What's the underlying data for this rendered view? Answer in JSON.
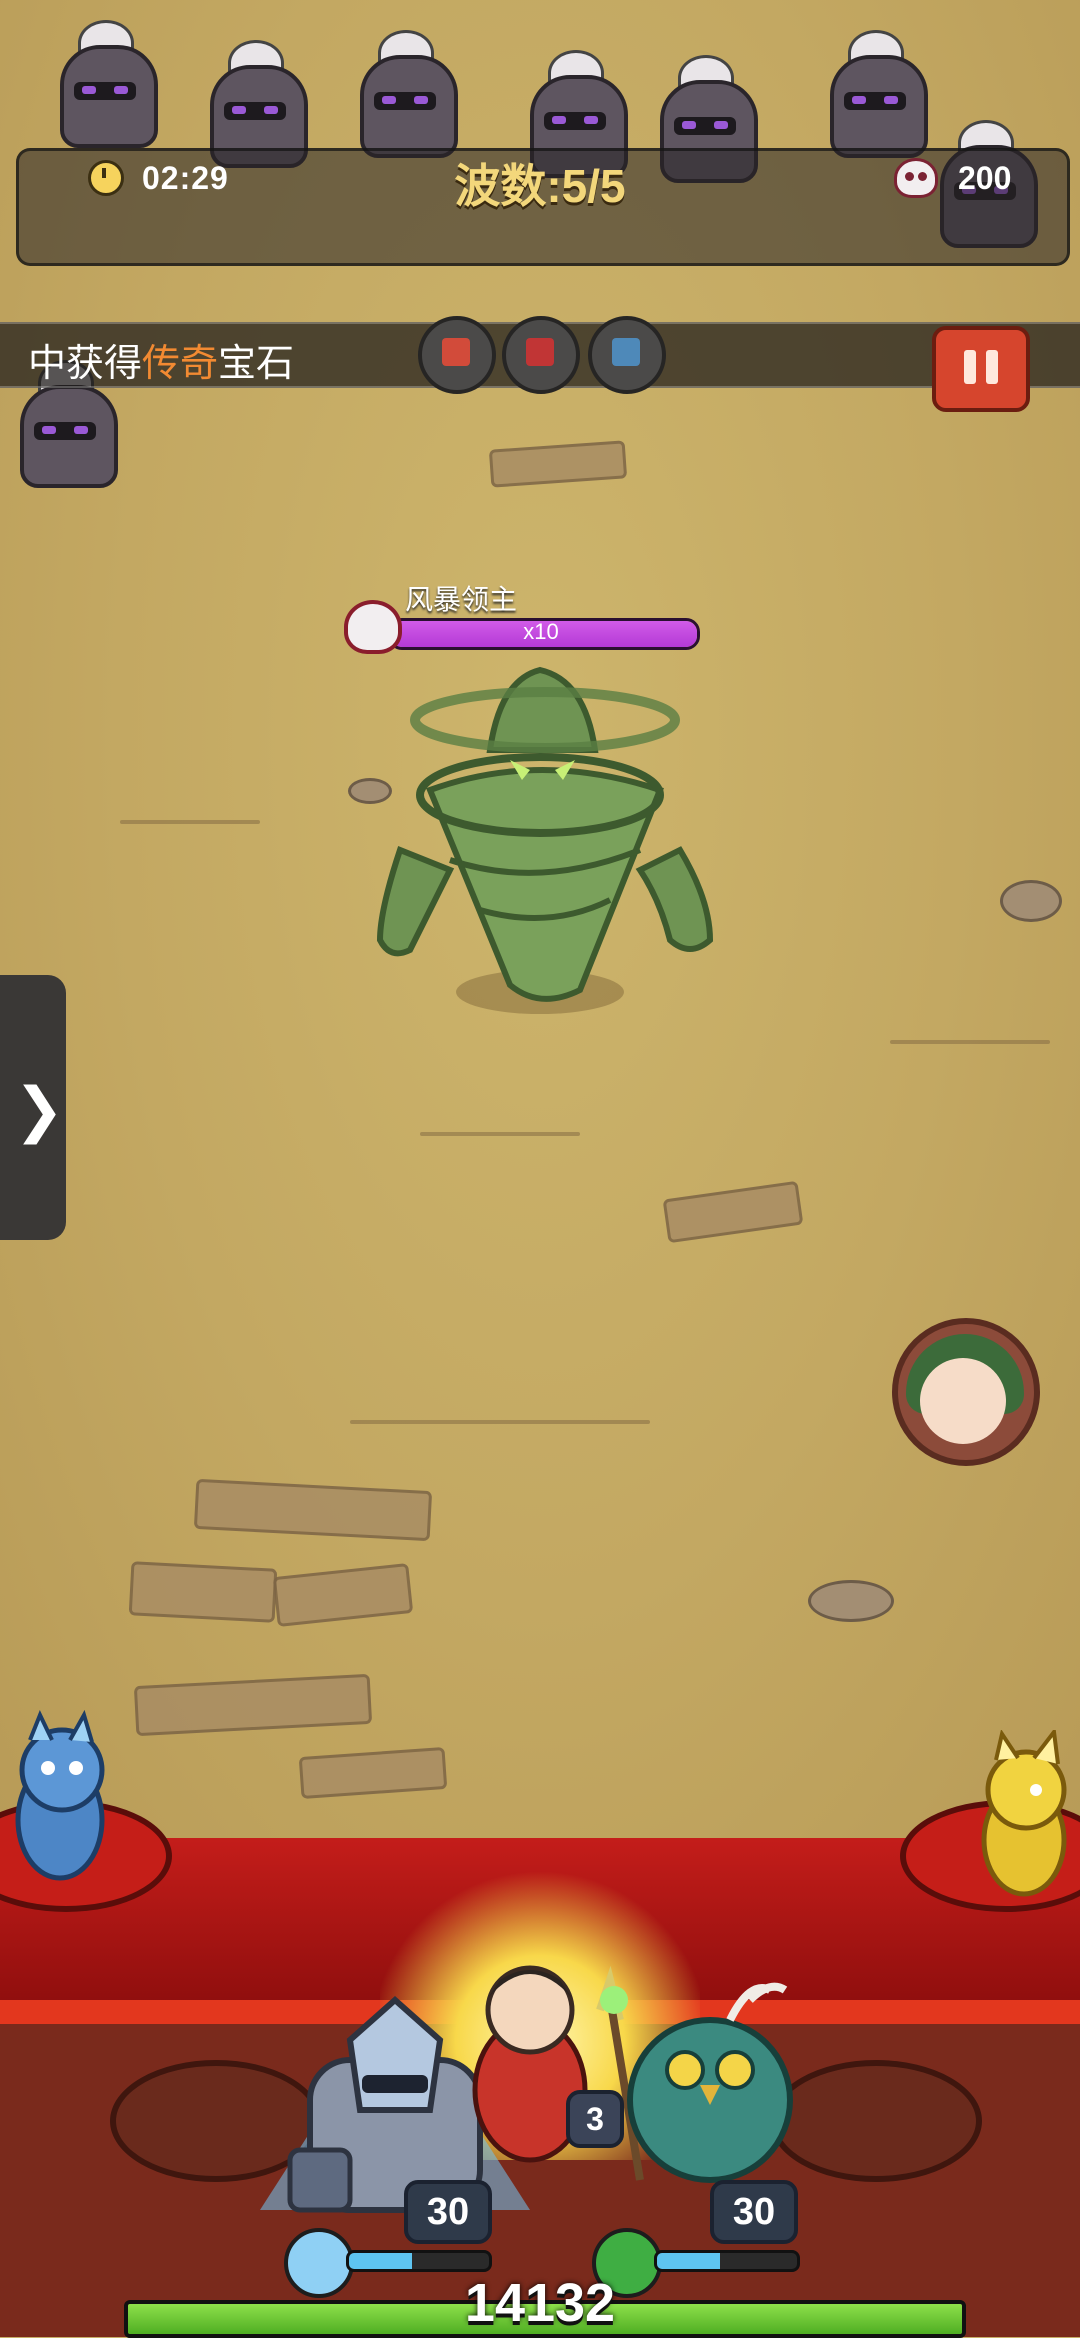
{
  "hud": {
    "timer": "02:29",
    "wave_label": "波数:5/5",
    "kill_count": "200"
  },
  "notice": {
    "prefix": "中获得",
    "highlight": "传奇",
    "suffix": "宝石"
  },
  "boss": {
    "name": "风暴领主",
    "multiplier": "x10",
    "hp_fraction": 1.0
  },
  "side_tab": {
    "arrow": "❯"
  },
  "heroes": [
    {
      "name": "frost-knight",
      "level": "30",
      "element": "ice",
      "energy_fraction": 0.45
    },
    {
      "name": "owl-druid",
      "level": "30",
      "element": "wind",
      "energy_fraction": 0.45
    }
  ],
  "hidden_level": "3",
  "base": {
    "hp": "14132",
    "hp_fraction": 1.0
  },
  "colors": {
    "field": "#c8ae67",
    "boss_bar": "#c94ae0",
    "notice_highlight": "#f28a32",
    "base_bar": "#6ccd35"
  }
}
